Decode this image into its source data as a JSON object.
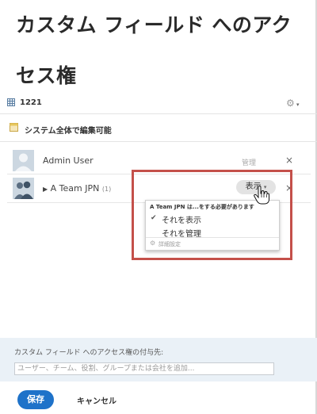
{
  "title": {
    "line1": "カスタム フィールド へのアク",
    "line2": "セス権"
  },
  "field": {
    "number": "1221",
    "editable_label": "システム全体で編集可能"
  },
  "access_list": [
    {
      "name": "Admin User",
      "permission": "管理"
    },
    {
      "name": "A Team JPN",
      "count": "(1)",
      "permission": "表示"
    }
  ],
  "dropdown": {
    "header": "A Team JPN は...をする必要があります",
    "options": [
      {
        "label": "それを表示",
        "checked": true
      },
      {
        "label": "それを管理",
        "checked": false
      }
    ],
    "advanced": "詳細設定"
  },
  "grant": {
    "label": "カスタム フィールド へのアクセス権の付与先:",
    "placeholder": "ユーザー、チーム、役割、グループまたは会社を追加..."
  },
  "footer": {
    "save": "保存",
    "cancel": "キャンセル"
  },
  "colors": {
    "primary": "#1e72c9",
    "highlight": "#c4504a",
    "grant_bg": "#eaf1f7"
  }
}
